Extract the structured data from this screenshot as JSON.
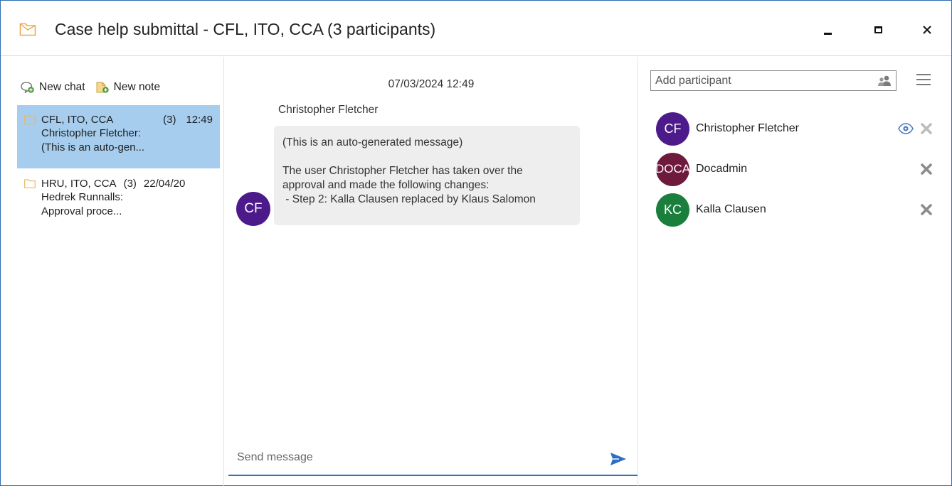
{
  "window": {
    "title": "Case help submittal - CFL, ITO, CCA (3 participants)"
  },
  "toolbar": {
    "new_chat_label": "New chat",
    "new_note_label": "New note"
  },
  "chats": [
    {
      "names": "CFL, ITO, CCA",
      "count": "(3)",
      "time": "12:49",
      "sender": "Christopher Fletcher:",
      "preview": "(This is an auto-gen...",
      "selected": true
    },
    {
      "names": "HRU, ITO, CCA",
      "count": "(3)",
      "time": "22/04/20",
      "sender": "Hedrek Runnalls:",
      "preview": "Approval proce...",
      "selected": false
    }
  ],
  "conversation": {
    "date": "07/03/2024 12:49",
    "sender": "Christopher Fletcher",
    "avatar_initials": "CF",
    "message_lines": [
      "(This is an auto-generated message)",
      "",
      "The user Christopher Fletcher has taken over the",
      "approval and made the following changes:",
      " - Step 2: Kalla Clausen replaced by Klaus Salomon"
    ]
  },
  "composer": {
    "placeholder": "Send message"
  },
  "participants_panel": {
    "add_placeholder": "Add participant",
    "participants": [
      {
        "initials": "CF",
        "name": "Christopher Fletcher",
        "color": "#4c1a8a",
        "watching": true
      },
      {
        "initials": "DOCA",
        "name": "Docadmin",
        "color": "#6e1a3c",
        "watching": false
      },
      {
        "initials": "KC",
        "name": "Kalla Clausen",
        "color": "#1a7f3c",
        "watching": false
      }
    ]
  },
  "colors": {
    "accent": "#2f6fc0",
    "selection": "#a6cdee",
    "folder": "#f0c26a"
  }
}
